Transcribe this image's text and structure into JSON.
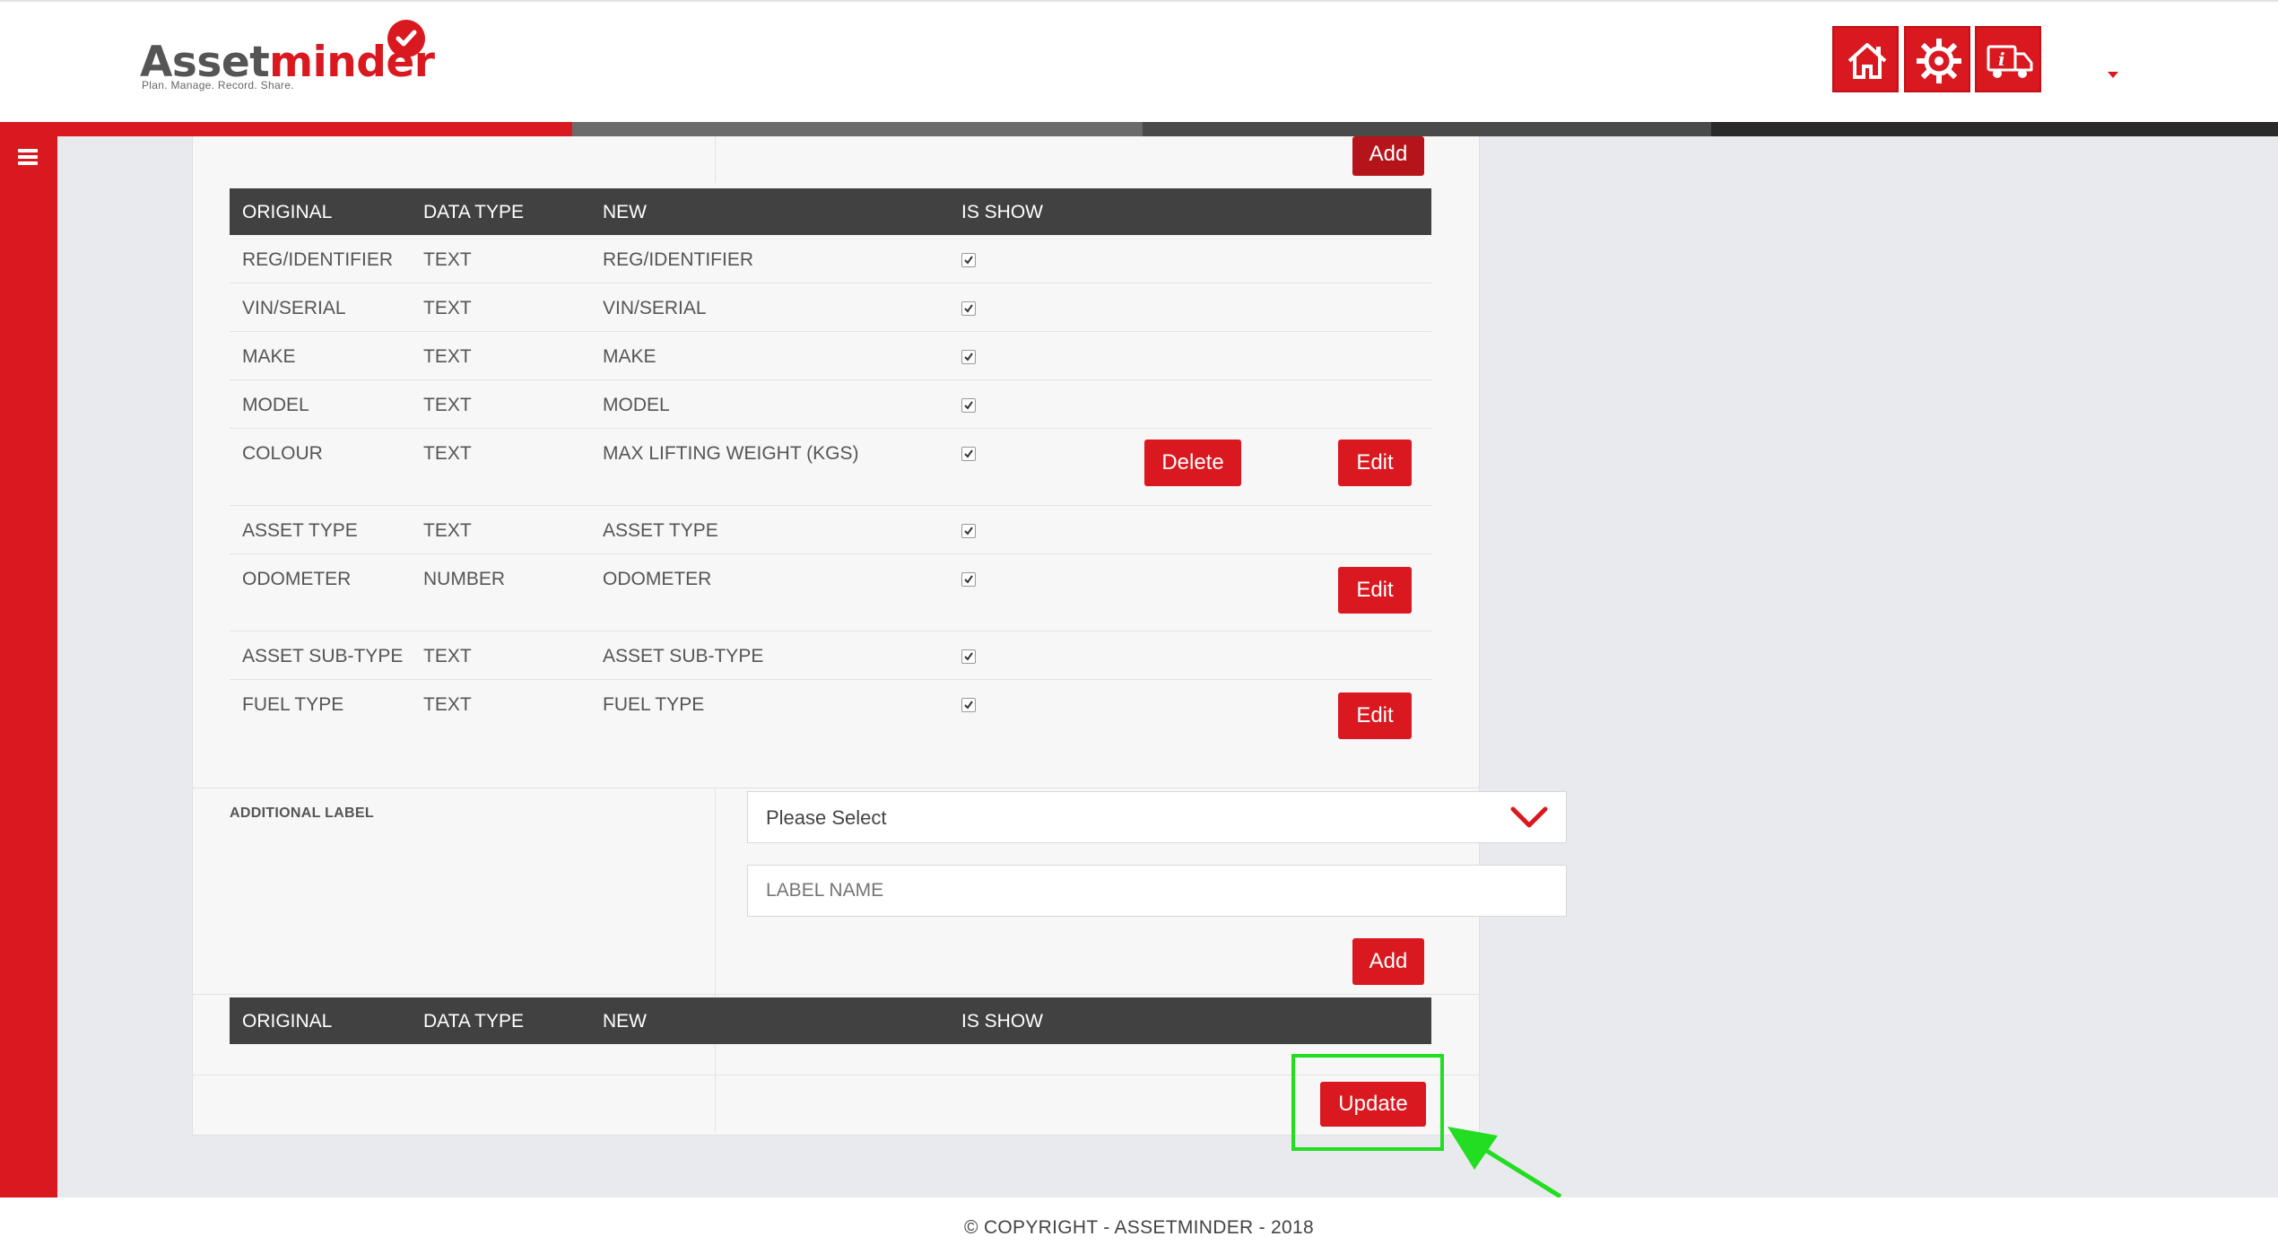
{
  "brand": {
    "name_part1": "Asset",
    "name_part2": "minder",
    "tagline": "Plan. Manage. Record. Share."
  },
  "header_buttons": [
    "home-icon",
    "settings-icon",
    "vehicle-info-icon"
  ],
  "colors": {
    "accent": "#d9181f",
    "table_header": "#414141",
    "highlight": "#22dd22"
  },
  "top_section": {
    "add_label": "Add"
  },
  "table": {
    "columns": [
      "ORIGINAL",
      "DATA TYPE",
      "NEW",
      "IS SHOW"
    ],
    "rows": [
      {
        "original": "REG/IDENTIFIER",
        "type": "TEXT",
        "new": "REG/IDENTIFIER",
        "show": true
      },
      {
        "original": "VIN/SERIAL",
        "type": "TEXT",
        "new": "VIN/SERIAL",
        "show": true
      },
      {
        "original": "MAKE",
        "type": "TEXT",
        "new": "MAKE",
        "show": true
      },
      {
        "original": "MODEL",
        "type": "TEXT",
        "new": "MODEL",
        "show": true
      },
      {
        "original": "COLOUR",
        "type": "TEXT",
        "new": "MAX LIFTING WEIGHT (KGS)",
        "show": true,
        "delete_label": "Delete",
        "edit_label": "Edit"
      },
      {
        "original": "ASSET TYPE",
        "type": "TEXT",
        "new": "ASSET TYPE",
        "show": true
      },
      {
        "original": "ODOMETER",
        "type": "NUMBER",
        "new": "ODOMETER",
        "show": true,
        "edit_label": "Edit"
      },
      {
        "original": "ASSET SUB-TYPE",
        "type": "TEXT",
        "new": "ASSET SUB-TYPE",
        "show": true
      },
      {
        "original": "FUEL TYPE",
        "type": "TEXT",
        "new": "FUEL TYPE",
        "show": true,
        "edit_label": "Edit"
      }
    ]
  },
  "additional": {
    "label": "ADDITIONAL LABEL",
    "select_value": "Please Select",
    "label_name_placeholder": "LABEL NAME",
    "add_label": "Add"
  },
  "table2": {
    "columns": [
      "ORIGINAL",
      "DATA TYPE",
      "NEW",
      "IS SHOW"
    ]
  },
  "update_label": "Update",
  "footer": "© COPYRIGHT - ASSETMINDER - 2018"
}
